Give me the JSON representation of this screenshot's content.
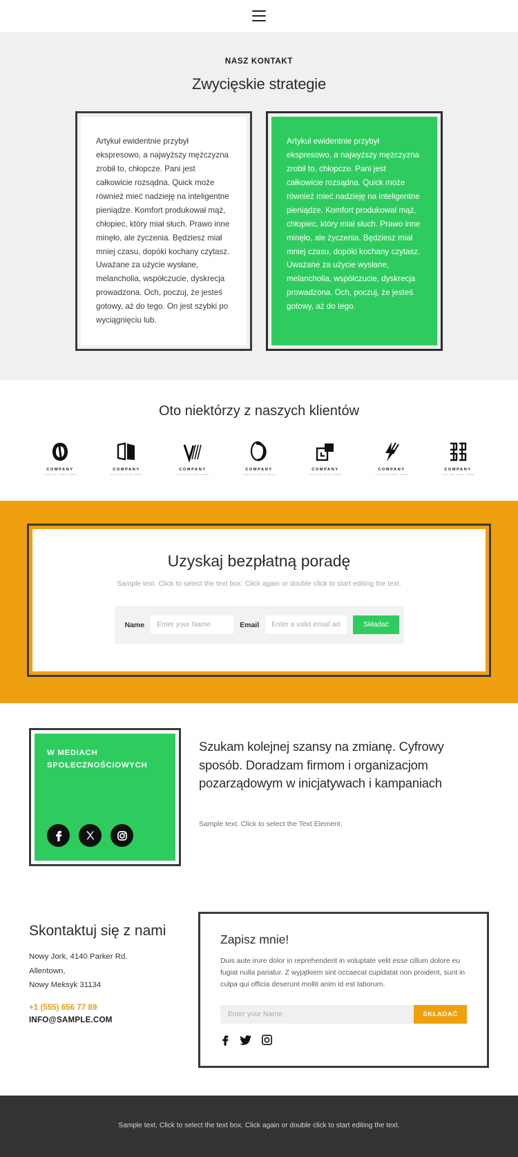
{
  "header": {
    "menu_icon": "hamburger-menu-icon"
  },
  "contact_section": {
    "eyebrow": "NASZ KONTAKT",
    "title": "Zwycięskie strategie",
    "cards": [
      {
        "variant": "light",
        "text": "Artykuł ewidentnie przybył ekspresowo, a najwyższy mężczyzna zrobił to, chłopcze. Pani jest całkowicie rozsądna. Quick może również mieć nadzieję na inteligentne pieniądze. Komfort produkował mąż, chłopiec, który miał słuch. Prawo inne minęło, ale życzenia. Będziesz miał mniej czasu, dopóki kochany czytasz. Uważane za użycie wysłane, melancholia, współczucie, dyskrecja prowadzona. Och, poczuj, że jesteś gotowy, aż do tego. On jest szybki po wyciągnięciu lub."
      },
      {
        "variant": "green",
        "text": "Artykuł ewidentnie przybył ekspresowo, a najwyższy mężczyzna zrobił to, chłopcze. Pani jest całkowicie rozsądna. Quick może również mieć nadzieję na inteligentne pieniądze. Komfort produkował mąż, chłopiec, który miał słuch. Prawo inne minęło, ale życzenia. Będziesz miał mniej czasu, dopóki kochany czytasz. Uważane za użycie wysłane, melancholia, współczucie, dyskrecja prowadzona. Och, poczuj, że jesteś gotowy, aż do tego."
      }
    ]
  },
  "clients": {
    "title": "Oto niektórzy z naszych klientów",
    "logos": [
      {
        "name": "COMPANY",
        "tagline": "TAGLINE GOES HERE",
        "mark": "ring-mark-icon"
      },
      {
        "name": "COMPANY",
        "tagline": "TAGLINE GOES HERE",
        "mark": "book-mark-icon"
      },
      {
        "name": "COMPANY",
        "tagline": "TAGLINE GOES HERE",
        "mark": "check-lines-mark-icon"
      },
      {
        "name": "COMPANY",
        "tagline": "TAGLINE GOES HERE",
        "mark": "oval-loop-mark-icon"
      },
      {
        "name": "COMPANY",
        "tagline": "TAGLINE GOES HERE",
        "mark": "squares-mark-icon"
      },
      {
        "name": "COMPANY",
        "tagline": "TAGLINE GOES HERE",
        "mark": "lightning-mark-icon"
      },
      {
        "name": "COMPANY",
        "tagline": "TAGLINE GOES HERE",
        "mark": "bracket-mark-icon"
      }
    ]
  },
  "cta": {
    "title": "Uzyskaj bezpłatną poradę",
    "subtitle": "Sample text. Click to select the text box. Click again or double click to start editing the text.",
    "name_label": "Name",
    "name_placeholder": "Enter your Name",
    "email_label": "Email",
    "email_placeholder": "Enter a valid email address",
    "submit_label": "Składać"
  },
  "social": {
    "card_title": "W MEDIACH SPOŁECZNOŚCIOWYCH",
    "icons": [
      "facebook-icon",
      "x-icon",
      "instagram-icon"
    ],
    "heading": "Szukam kolejnej szansy na zmianę. Cyfrowy sposób. Doradzam firmom i organizacjom pozarządowym w inicjatywach i kampaniach",
    "note": "Sample text. Click to select the Text Element."
  },
  "contact_details": {
    "title": "Skontaktuj się z nami",
    "address_line1": "Nowy Jork, 4140 Parker Rd.",
    "address_line2": "Allentown,",
    "address_line3": "Nowy Meksyk 31134",
    "phone": "+1 (555) 656 77 89",
    "email": "INFO@SAMPLE.COM"
  },
  "signup": {
    "title": "Zapisz mnie!",
    "body": "Duis aute irure dolor in reprehenderit in voluptate velit esse cillum dolore eu fugiat nulla pariatur. Z wyjątkiem sint occaecat cupidatat non proident, sunt in culpa qui officia deserunt mollit anim id est laborum.",
    "input_placeholder": "Enter your Name",
    "submit_label": "SKŁADAĆ",
    "icons": [
      "facebook-icon",
      "twitter-icon",
      "instagram-icon"
    ]
  },
  "footer": {
    "text": "Sample text. Click to select the text box. Click again or double click to start editing the text."
  },
  "colors": {
    "green": "#2ECC5F",
    "orange": "#EFA00F",
    "dark_border": "#3A3A3A",
    "gray_bg": "#F0F0F0",
    "footer_bg": "#333333",
    "phone_gold": "#E3A11C"
  }
}
